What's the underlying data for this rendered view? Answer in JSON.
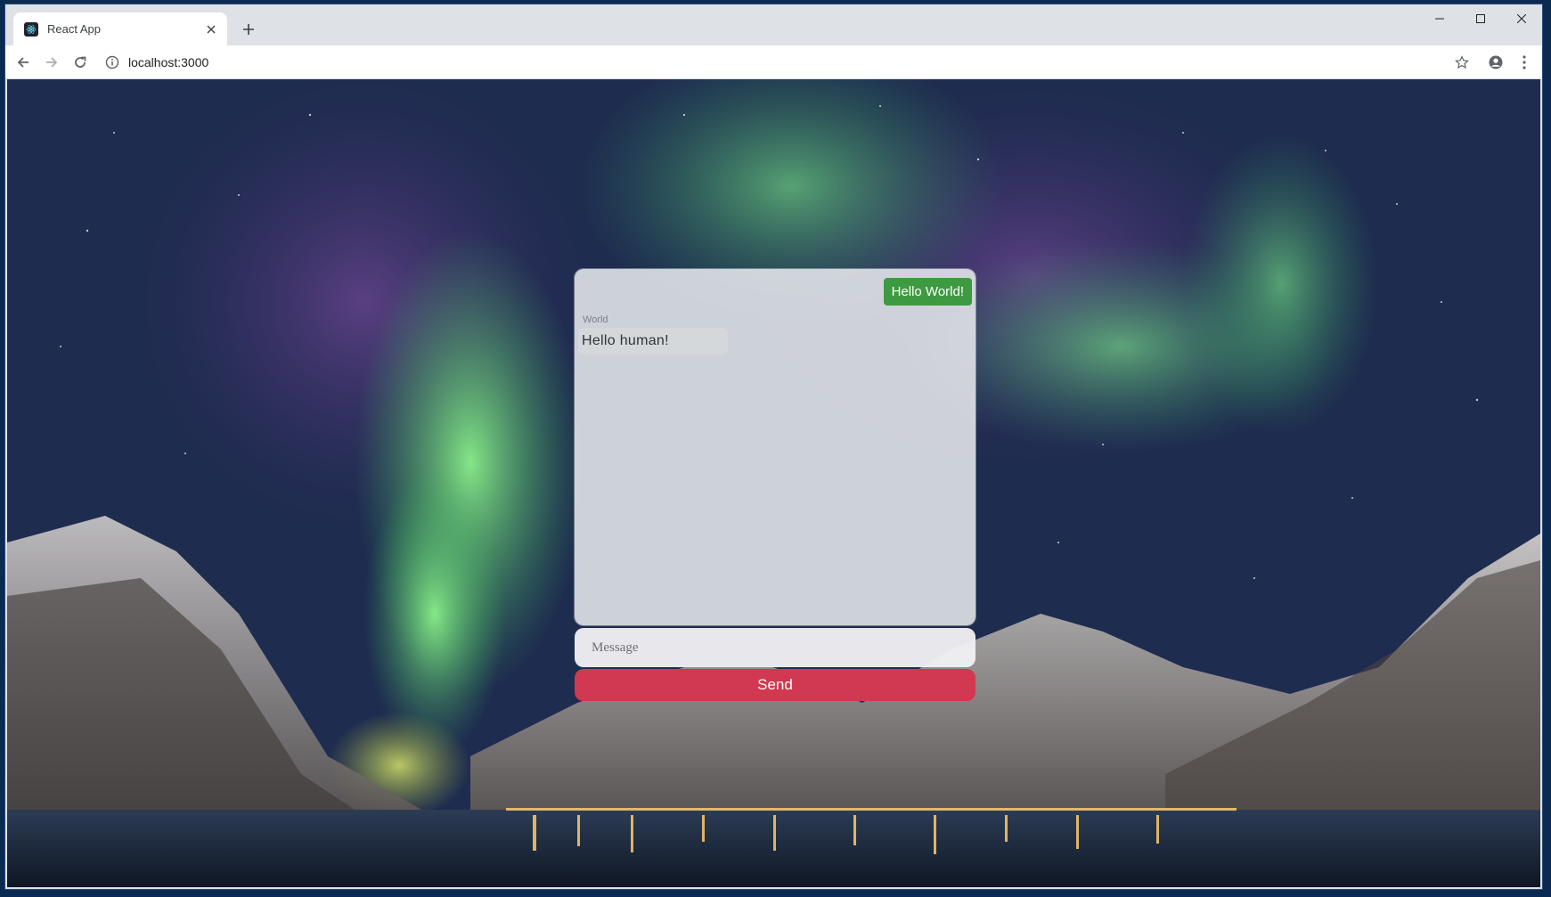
{
  "browser": {
    "tab": {
      "title": "React App",
      "favicon": "react-icon"
    },
    "new_tab_icon": "plus-icon",
    "window_controls": [
      "minimize-icon",
      "maximize-icon",
      "close-icon"
    ],
    "address": "localhost:3000",
    "toolbar_icons": {
      "back": "arrow-left-icon",
      "forward": "arrow-right-icon",
      "reload": "reload-icon",
      "info": "info-icon",
      "bookmark": "star-icon",
      "profile": "account-icon",
      "menu": "kebab-menu-icon"
    }
  },
  "chat": {
    "messages": [
      {
        "direction": "sent",
        "text": "Hello World!"
      },
      {
        "direction": "received",
        "sender": "World",
        "text": "Hello human!"
      }
    ],
    "input": {
      "placeholder": "Message",
      "value": ""
    },
    "send_label": "Send"
  },
  "colors": {
    "sent_bubble": "#3e9a40",
    "send_button": "#d0394f",
    "panel": "#e6e8ec"
  }
}
